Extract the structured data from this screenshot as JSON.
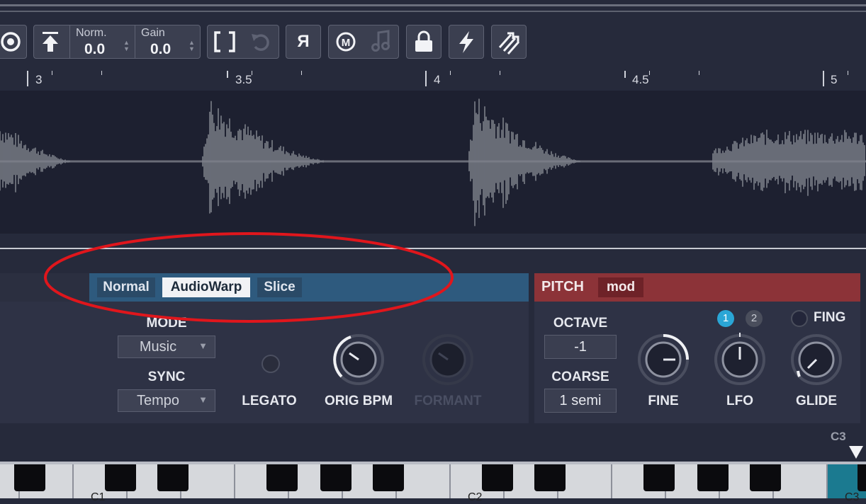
{
  "toolbar": {
    "norm_label": "Norm.",
    "norm_value": "0.0",
    "gain_label": "Gain",
    "gain_value": "0.0",
    "reverse_label": "Я",
    "icons": [
      "record-icon",
      "play-start-icon",
      "loop-brackets-icon",
      "undo-icon",
      "reverse-icon",
      "midi-m-icon",
      "music-note-icon",
      "lock-icon",
      "lightning-icon",
      "tempo-arrows-icon"
    ]
  },
  "ruler": {
    "labels": [
      "3",
      "3.5",
      "4",
      "4.5",
      "5"
    ]
  },
  "mode_tabs": {
    "normal": "Normal",
    "audiowarp": "AudioWarp",
    "slice": "Slice",
    "selected": "AudioWarp"
  },
  "controls": {
    "mode_label": "MODE",
    "mode_value": "Music",
    "sync_label": "SYNC",
    "sync_value": "Tempo",
    "legato_label": "LEGATO",
    "orig_bpm_label": "ORIG BPM",
    "formant_label": "FORMANT"
  },
  "pitch": {
    "title": "PITCH",
    "mod_label": "mod",
    "octave_label": "OCTAVE",
    "octave_value": "-1",
    "coarse_label": "COARSE",
    "coarse_value": "1 semi",
    "fine_label": "FINE",
    "lfo_label": "LFO",
    "lfo_1": "1",
    "lfo_2": "2",
    "fing_label": "FING",
    "glide_label": "GLIDE"
  },
  "keyboard": {
    "marker_label": "C3",
    "key_labels": [
      "C1",
      "C2",
      "C3"
    ]
  },
  "colors": {
    "mode_header": "#2e5a7e",
    "pitch_header": "#8c3338",
    "annotation": "#e0161c",
    "lfo_active": "#2aa6d6",
    "key_highlight": "#1b7a90"
  }
}
